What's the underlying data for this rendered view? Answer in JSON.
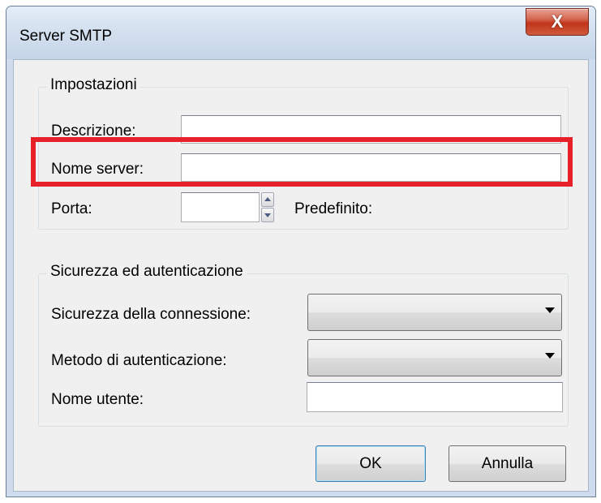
{
  "window": {
    "title": "Server SMTP",
    "close_label": "X"
  },
  "settings": {
    "legend": "Impostazioni",
    "description_label": "Descrizione:",
    "description_value": "",
    "server_name_label": "Nome server:",
    "server_name_value": "",
    "port_label": "Porta:",
    "port_value": "",
    "default_label": "Predefinito:"
  },
  "security": {
    "legend": "Sicurezza ed autenticazione",
    "connection_security_label": "Sicurezza della connessione:",
    "connection_security_value": "",
    "auth_method_label": "Metodo di autenticazione:",
    "auth_method_value": "",
    "username_label": "Nome utente:",
    "username_value": ""
  },
  "buttons": {
    "ok": "OK",
    "cancel": "Annulla"
  },
  "colors": {
    "highlight": "#e8202a",
    "window_frame": "#cfdced",
    "client_bg": "#f0f0f0"
  }
}
